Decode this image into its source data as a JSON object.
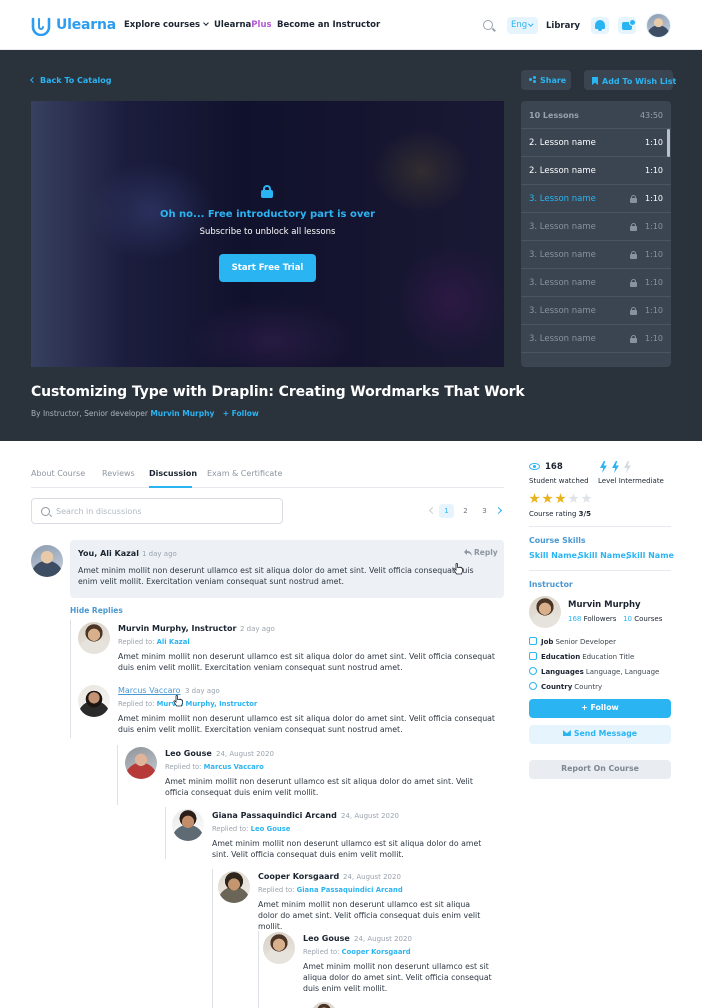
{
  "nav": {
    "logo": "Ulearna",
    "explore": "Explore courses",
    "brand_prefix": "Ulearna",
    "brand_suffix": "Plus",
    "become": "Become an Instructor",
    "lang": "Eng",
    "library": "Library"
  },
  "hero": {
    "back": "Back To Catalog",
    "share": "Share",
    "wishlist": "Add To Wish List",
    "locked_title": "Oh no... Free introductory part is over",
    "locked_sub": "Subscribe to unblock all lessons",
    "trial": "Start Free Trial",
    "course_title": "Customizing Type with Draplin: Creating Wordmarks That Work",
    "by_prefix": "By Instructor, Senior developer",
    "instructor": "Murvin Murphy",
    "follow": "Follow"
  },
  "playlist": {
    "count": "10 Lessons",
    "total": "43:50",
    "lessons": [
      {
        "name": "2. Lesson name",
        "dur": "1:10",
        "state": "unlocked"
      },
      {
        "name": "2. Lesson name",
        "dur": "1:10",
        "state": "unlocked"
      },
      {
        "name": "3. Lesson name",
        "dur": "1:10",
        "state": "active"
      },
      {
        "name": "3. Lesson name",
        "dur": "1:10",
        "state": "locked"
      },
      {
        "name": "3. Lesson name",
        "dur": "1:10",
        "state": "locked"
      },
      {
        "name": "3. Lesson name",
        "dur": "1:10",
        "state": "locked"
      },
      {
        "name": "3. Lesson name",
        "dur": "1:10",
        "state": "locked"
      },
      {
        "name": "3. Lesson name",
        "dur": "1:10",
        "state": "locked"
      }
    ]
  },
  "tabs": [
    "About Course",
    "Reviews",
    "Discussion",
    "Exam & Certificate"
  ],
  "active_tab": "Discussion",
  "search": {
    "placeholder": "Search in discussions"
  },
  "pagination": {
    "pages": [
      "1",
      "2",
      "3"
    ],
    "current": "1"
  },
  "discussion": {
    "main": {
      "name": "You, Ali Kazal",
      "time": "1 day ago",
      "reply": "Reply",
      "body": "Amet minim mollit non deserunt ullamco est sit aliqua dolor do amet sint. Velit officia consequat duis enim velit mollit. Exercitation veniam consequat sunt nostrud amet."
    },
    "hide_replies": "Hide Replies",
    "replied_to_label": "Replied to:",
    "replies": [
      {
        "name": "Murvin Murphy, Instructor",
        "time": "2 day ago",
        "to": "Ali Kazal",
        "highlight": false,
        "body": "Amet minim mollit non deserunt ullamco est sit aliqua dolor do amet sint. Velit officia consequat duis enim velit mollit. Exercitation veniam consequat sunt nostrud amet."
      },
      {
        "name": "Marcus Vaccaro",
        "time": "3 day ago",
        "to": "Murvin Murphy, Instructor",
        "highlight": true,
        "body": "Amet minim mollit non deserunt ullamco est sit aliqua dolor do amet sint. Velit officia consequat duis enim velit mollit. Exercitation veniam consequat sunt nostrud amet."
      },
      {
        "name": "Leo Gouse",
        "time": "24, August 2020",
        "to": "Marcus Vaccaro",
        "highlight": false,
        "body": "Amet minim mollit non deserunt ullamco est sit aliqua dolor do amet sint. Velit officia consequat duis enim velit mollit."
      },
      {
        "name": "Giana Passaquindici Arcand",
        "time": "24, August 2020",
        "to": "Leo Gouse",
        "highlight": false,
        "body": "Amet minim mollit non deserunt ullamco est sit aliqua dolor do amet sint. Velit officia consequat duis enim velit mollit."
      },
      {
        "name": "Cooper Korsgaard",
        "time": "24, August 2020",
        "to": "Giana Passaquindici Arcand",
        "highlight": false,
        "body": "Amet minim mollit non deserunt ullamco est sit aliqua dolor do amet sint. Velit officia consequat duis enim velit mollit."
      },
      {
        "name": "Leo Gouse",
        "time": "24, August 2020",
        "to": "Cooper Korsgaard",
        "highlight": false,
        "body": "Amet minim mollit non deserunt ullamco est sit aliqua dolor do amet sint. Velit officia consequat duis enim velit mollit."
      }
    ]
  },
  "sidebar": {
    "watched_count": "168",
    "watched_label": "Student watched",
    "level_label": "Level Intermediate",
    "level_value": 2,
    "level_max": 3,
    "rating_value": 3,
    "rating_max": 5,
    "rating_label": "Course rating",
    "rating_text": "3/5",
    "skills_head": "Course Skills",
    "skills": [
      "Skill Name,",
      "Skill Name,",
      "Skill Name"
    ],
    "instructor_head": "Instructor",
    "instructor_name": "Murvin Murphy",
    "followers_count": "168",
    "followers_label": "Followers",
    "courses_count": "10",
    "courses_label": "Courses",
    "info": [
      {
        "label": "Job",
        "value": "Senior Developer"
      },
      {
        "label": "Education",
        "value": "Education Title"
      },
      {
        "label": "Languages",
        "value": "Language, Language"
      },
      {
        "label": "Country",
        "value": "Country"
      }
    ],
    "follow_btn": "Follow",
    "message_btn": "Send Message",
    "report_btn": "Report On Course"
  },
  "colors": {
    "accent": "#2bb4f2",
    "hero_bg": "#2a323c",
    "panel_bg": "#3a4551",
    "plus": "#b35ad6"
  }
}
